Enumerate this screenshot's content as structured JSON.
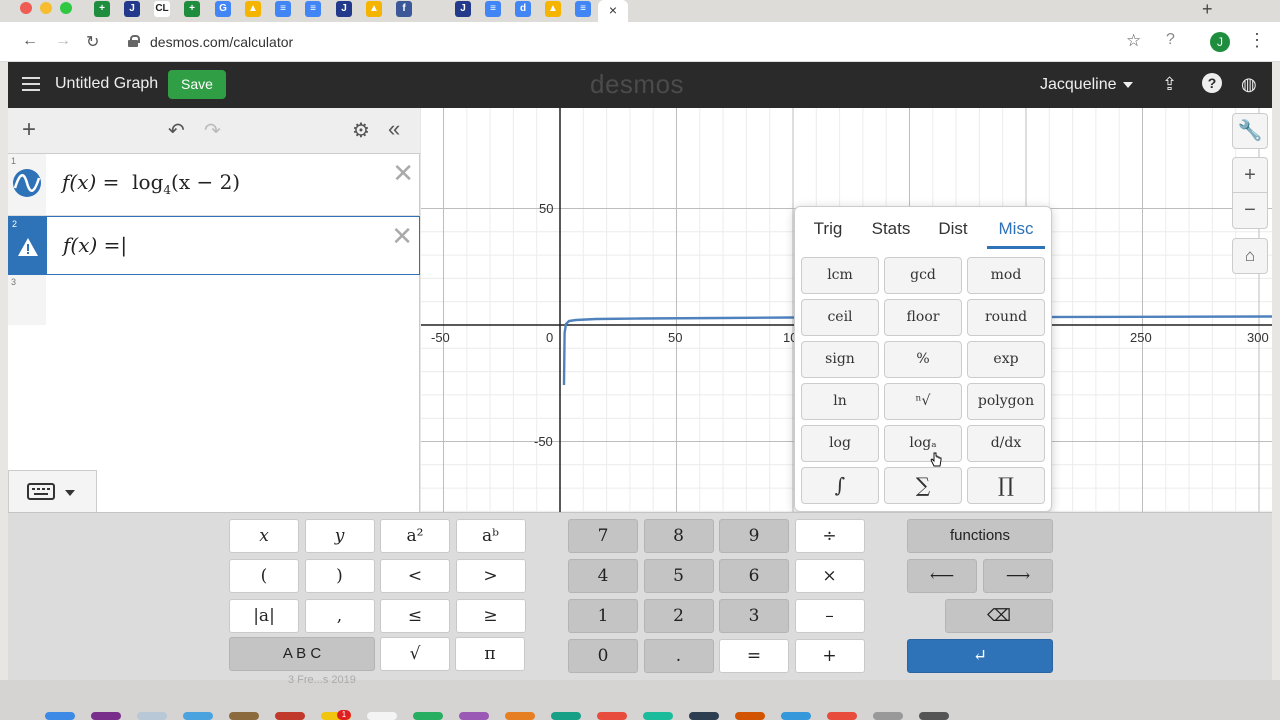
{
  "browser": {
    "url": "desmos.com/calculator",
    "active_tab_close": "×",
    "new_tab": "+",
    "profile_initial": "J",
    "tab_icons": [
      {
        "label": "+",
        "color": "#1e8e3e"
      },
      {
        "label": "J",
        "color": "#233a8c"
      },
      {
        "label": "CL",
        "color": "#ffffff"
      },
      {
        "label": "+",
        "color": "#1e8e3e"
      },
      {
        "label": "G",
        "color": "#4285f4"
      },
      {
        "label": "▲",
        "color": "#f4b400"
      },
      {
        "label": "≡",
        "color": "#4285f4"
      },
      {
        "label": "≡",
        "color": "#4285f4"
      },
      {
        "label": "J",
        "color": "#233a8c"
      },
      {
        "label": "▲",
        "color": "#f4b400"
      },
      {
        "label": "f",
        "color": "#3b5998"
      },
      {
        "label": "J",
        "color": "#233a8c"
      },
      {
        "label": "≡",
        "color": "#4285f4"
      },
      {
        "label": "d",
        "color": "#4285f4"
      },
      {
        "label": "▲",
        "color": "#f4b400"
      },
      {
        "label": "≡",
        "color": "#4285f4"
      }
    ]
  },
  "header": {
    "graph_title": "Untitled Graph",
    "save_label": "Save",
    "logo": "desmos",
    "user_name": "Jacqueline"
  },
  "expressions": [
    {
      "index": "1",
      "lhs": "f(x) =",
      "rhs_func": "log",
      "rhs_base": "4",
      "rhs_arg": "(x − 2)"
    },
    {
      "index": "2",
      "lhs": "f(x) =",
      "cursor": "|"
    },
    {
      "index": "3"
    }
  ],
  "graph": {
    "x_ticks": [
      "-50",
      "0",
      "50",
      "10",
      "250",
      "300"
    ],
    "y_ticks": [
      "50",
      "-50"
    ],
    "curve_color": "#4f81bd"
  },
  "functions_popover": {
    "tabs": [
      "Trig",
      "Stats",
      "Dist",
      "Misc"
    ],
    "active_tab": "Misc",
    "buttons": [
      [
        "lcm",
        "gcd",
        "mod"
      ],
      [
        "ceil",
        "floor",
        "round"
      ],
      [
        "sign",
        "%",
        "exp"
      ],
      [
        "ln",
        "ⁿ√",
        "polygon"
      ],
      [
        "log",
        "logₐ",
        "d/dx"
      ],
      [
        "∫",
        "∑",
        "∏"
      ]
    ]
  },
  "keypad": {
    "left": [
      [
        "x",
        "y",
        "a²",
        "aᵇ"
      ],
      [
        "(",
        ")",
        "<",
        ">"
      ],
      [
        "|a|",
        ",",
        "≤",
        "≥"
      ]
    ],
    "abc": "A B C",
    "sqrt": "√",
    "pi": "π",
    "numbers": [
      [
        "7",
        "8",
        "9",
        "÷"
      ],
      [
        "4",
        "5",
        "6",
        "×"
      ],
      [
        "1",
        "2",
        "3",
        "–"
      ],
      [
        "0",
        ".",
        "=",
        "+"
      ]
    ],
    "functions_label": "functions",
    "left_arrow": "⟵",
    "right_arrow": "⟶",
    "backspace": "⌫",
    "enter": "↵"
  },
  "dock": {
    "faint_text": "3 Fre...s 2019",
    "badge": "1"
  }
}
